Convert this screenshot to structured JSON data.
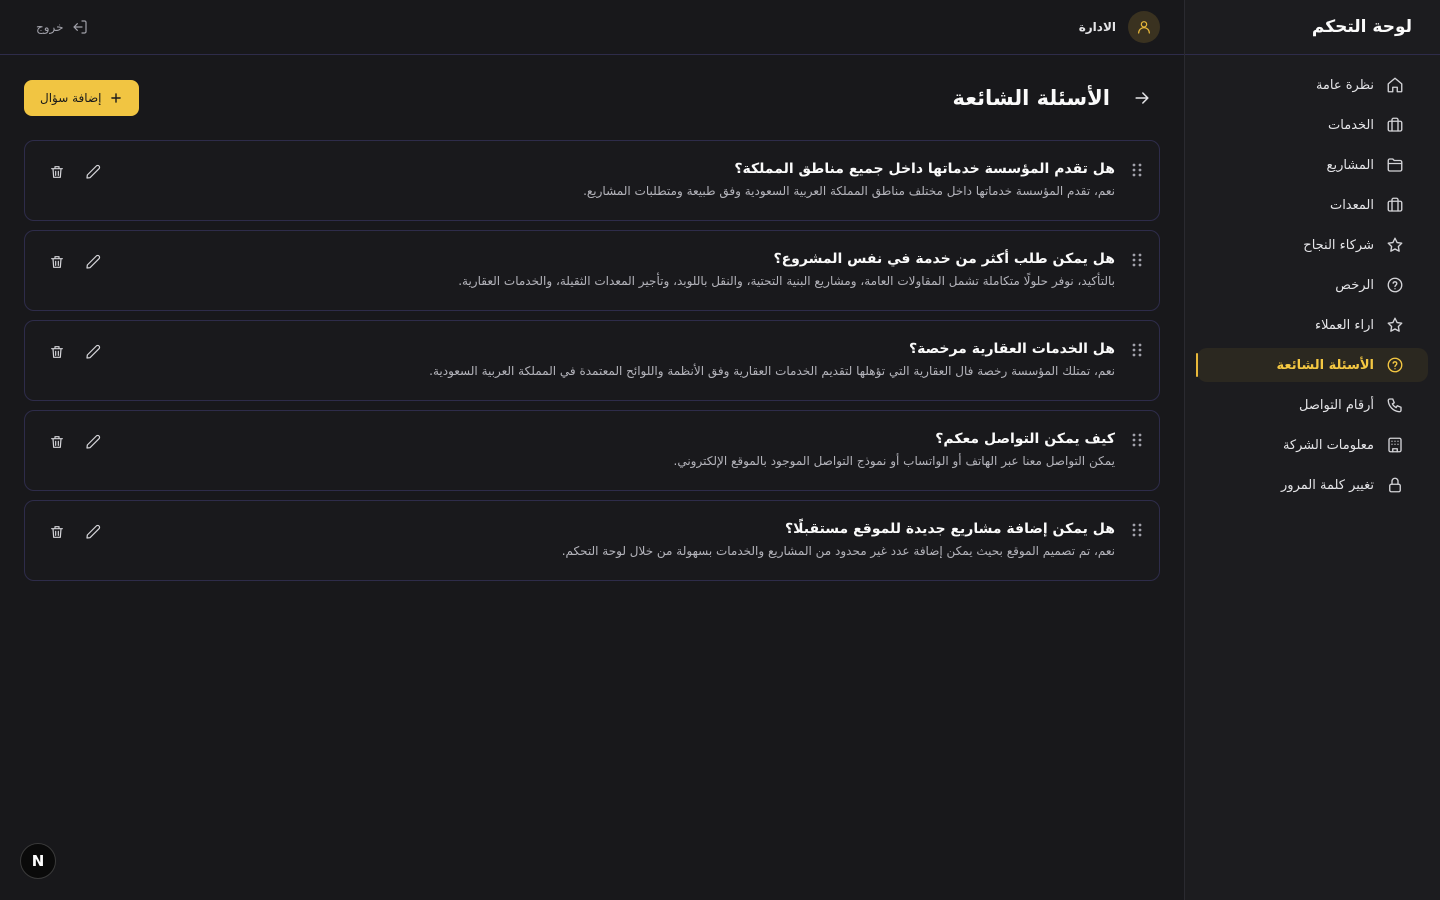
{
  "sidebar": {
    "title": "لوحة التحكم",
    "items": [
      {
        "label": "نظرة عامة",
        "icon": "home-icon",
        "active": false
      },
      {
        "label": "الخدمات",
        "icon": "briefcase-icon",
        "active": false
      },
      {
        "label": "المشاريع",
        "icon": "folder-icon",
        "active": false
      },
      {
        "label": "المعدات",
        "icon": "briefcase-icon",
        "active": false
      },
      {
        "label": "شركاء النجاح",
        "icon": "star-icon",
        "active": false
      },
      {
        "label": "الرخص",
        "icon": "help-circle-icon",
        "active": false
      },
      {
        "label": "اراء العملاء",
        "icon": "star-icon",
        "active": false
      },
      {
        "label": "الأسئلة الشائعة",
        "icon": "help-circle-icon",
        "active": true
      },
      {
        "label": "أرقام التواصل",
        "icon": "phone-icon",
        "active": false
      },
      {
        "label": "معلومات الشركة",
        "icon": "building-icon",
        "active": false
      },
      {
        "label": "تغيير كلمة المرور",
        "icon": "lock-icon",
        "active": false
      }
    ]
  },
  "topbar": {
    "user_name": "الادارة",
    "logout_label": "خروج"
  },
  "page": {
    "title": "الأسئلة الشائعة",
    "add_button_label": "إضافة سؤال"
  },
  "faqs": [
    {
      "question": "هل تقدم المؤسسة خدماتها داخل جميع مناطق المملكة؟",
      "answer": "نعم، تقدم المؤسسة خدماتها داخل مختلف مناطق المملكة العربية السعودية وفق طبيعة ومتطلبات المشاريع."
    },
    {
      "question": "هل يمكن طلب أكثر من خدمة في نفس المشروع؟",
      "answer": "بالتأكيد، نوفر حلولًا متكاملة تشمل المقاولات العامة، ومشاريع البنية التحتية، والنقل باللوبد، وتأجير المعدات الثقيلة، والخدمات العقارية."
    },
    {
      "question": "هل الخدمات العقارية مرخصة؟",
      "answer": "نعم، تمتلك المؤسسة رخصة فال العقارية التي تؤهلها لتقديم الخدمات العقارية وفق الأنظمة واللوائح المعتمدة في المملكة العربية السعودية."
    },
    {
      "question": "كيف يمكن التواصل معكم؟",
      "answer": "يمكن التواصل معنا عبر الهاتف أو الواتساب أو نموذج التواصل الموجود بالموقع الإلكتروني."
    },
    {
      "question": "هل يمكن إضافة مشاريع جديدة للموقع مستقبلًا؟",
      "answer": "نعم، تم تصميم الموقع بحيث يمكن إضافة عدد غير محدود من المشاريع والخدمات بسهولة من خلال لوحة التحكم."
    }
  ],
  "badge": {
    "label": "N"
  },
  "colors": {
    "accent": "#f1c542",
    "background": "#18181b",
    "border": "#2e2c4a"
  }
}
